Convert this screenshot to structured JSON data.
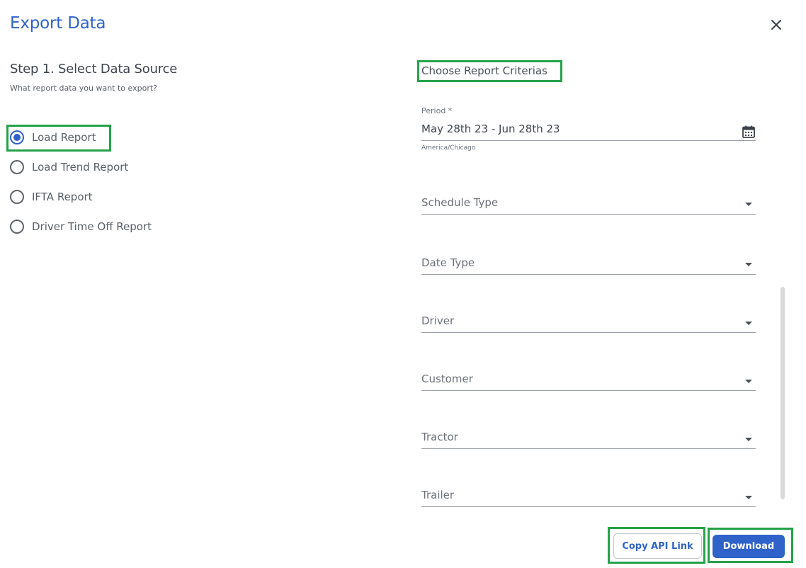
{
  "dialog": {
    "title": "Export Data"
  },
  "step": {
    "title": "Step 1. Select Data Source",
    "subtitle": "What report data you want to export?",
    "options": [
      {
        "label": "Load Report",
        "checked": true
      },
      {
        "label": "Load Trend Report",
        "checked": false
      },
      {
        "label": "IFTA Report",
        "checked": false
      },
      {
        "label": "Driver Time Off Report",
        "checked": false
      }
    ]
  },
  "criteria": {
    "title": "Choose Report Criterias",
    "period": {
      "label": "Period *",
      "value": "May 28th 23 - Jun 28th 23",
      "timezone": "America/Chicago",
      "icon": "calendar-icon"
    },
    "selects": [
      {
        "placeholder": "Schedule Type"
      },
      {
        "placeholder": "Date Type"
      },
      {
        "placeholder": "Driver"
      },
      {
        "placeholder": "Customer"
      },
      {
        "placeholder": "Tractor"
      },
      {
        "placeholder": "Trailer"
      }
    ]
  },
  "actions": {
    "copy_api_label": "Copy API Link",
    "download_label": "Download"
  },
  "colors": {
    "accent": "#2f63c9",
    "highlight": "#25a24a"
  }
}
